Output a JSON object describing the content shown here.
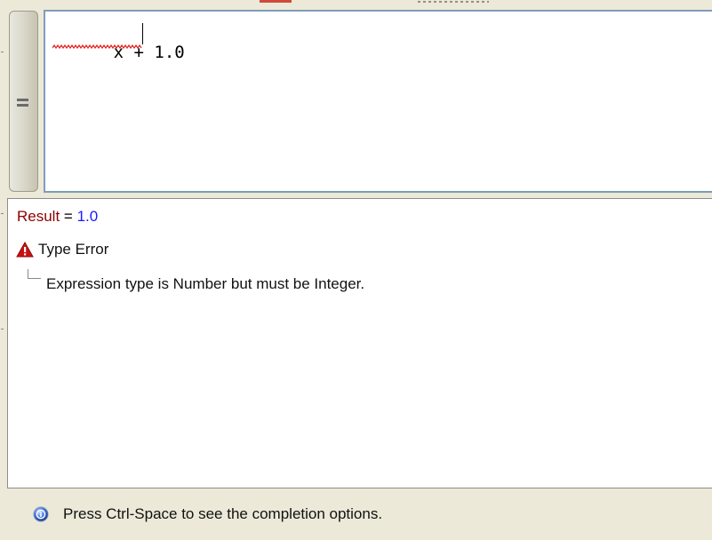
{
  "editor": {
    "expression": "x + 1.0"
  },
  "results": {
    "result_label": "Result",
    "result_equals": " = ",
    "result_value": "1.0",
    "error_title": "Type Error",
    "error_detail": "Expression type is Number but must be Integer."
  },
  "status_bar": {
    "hint": "Press Ctrl-Space to see the completion options."
  },
  "icons": {
    "grip": "grip-lines-icon",
    "warning": "warning-triangle-icon",
    "help": "help-info-icon"
  },
  "colors": {
    "result_label": "#8b0000",
    "result_value": "#1a1aff",
    "warning_red": "#cc1111",
    "help_blue": "#3a6fd8",
    "editor_border": "#7f9db9",
    "squiggle": "#e02020"
  }
}
